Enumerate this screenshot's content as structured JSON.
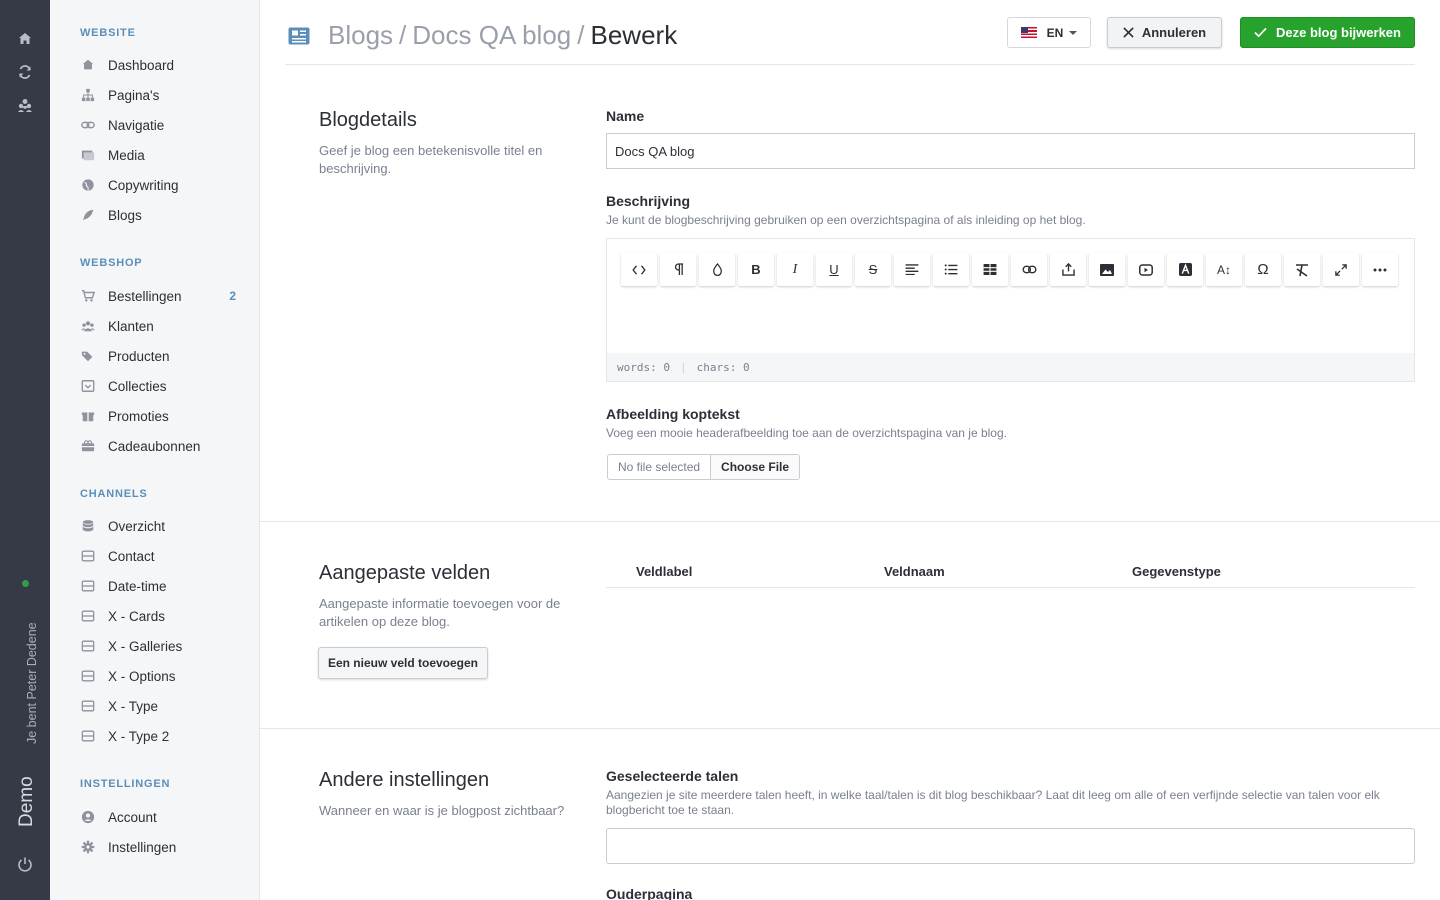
{
  "rail": {
    "user_text": "Je bent Peter Dedene",
    "site_name": "Demo",
    "icons": [
      "home-icon",
      "refresh-icon",
      "users-icon",
      "power-icon"
    ]
  },
  "sidebar": {
    "sections": [
      {
        "title": "WEBSITE",
        "items": [
          {
            "label": "Dashboard",
            "icon": "home-icon"
          },
          {
            "label": "Pagina's",
            "icon": "sitemap-icon"
          },
          {
            "label": "Navigatie",
            "icon": "link-icon"
          },
          {
            "label": "Media",
            "icon": "images-icon"
          },
          {
            "label": "Copywriting",
            "icon": "globe-icon"
          },
          {
            "label": "Blogs",
            "icon": "feather-icon"
          }
        ]
      },
      {
        "title": "WEBSHOP",
        "items": [
          {
            "label": "Bestellingen",
            "icon": "cart-icon",
            "badge": "2"
          },
          {
            "label": "Klanten",
            "icon": "users-icon"
          },
          {
            "label": "Producten",
            "icon": "tags-icon"
          },
          {
            "label": "Collecties",
            "icon": "collection-icon"
          },
          {
            "label": "Promoties",
            "icon": "gift-icon"
          },
          {
            "label": "Cadeaubonnen",
            "icon": "giftcard-icon"
          }
        ]
      },
      {
        "title": "CHANNELS",
        "items": [
          {
            "label": "Overzicht",
            "icon": "database-icon"
          },
          {
            "label": "Contact",
            "icon": "box-icon"
          },
          {
            "label": "Date-time",
            "icon": "box-icon"
          },
          {
            "label": "X - Cards",
            "icon": "box-icon"
          },
          {
            "label": "X - Galleries",
            "icon": "box-icon"
          },
          {
            "label": "X - Options",
            "icon": "box-icon"
          },
          {
            "label": "X - Type",
            "icon": "box-icon"
          },
          {
            "label": "X - Type 2",
            "icon": "box-icon"
          }
        ]
      },
      {
        "title": "INSTELLINGEN",
        "items": [
          {
            "label": "Account",
            "icon": "user-circle-icon"
          },
          {
            "label": "Instellingen",
            "icon": "gear-icon"
          }
        ]
      }
    ]
  },
  "header": {
    "crumb1": "Blogs",
    "crumb2": "Docs QA blog",
    "crumb3": "Bewerk",
    "sep": "/",
    "lang": "EN",
    "cancel": "Annuleren",
    "save": "Deze blog bijwerken"
  },
  "details": {
    "title": "Blogdetails",
    "desc": "Geef je blog een betekenisvolle titel en beschrijving.",
    "name_label": "Name",
    "name_value": "Docs QA blog",
    "desc_label": "Beschrijving",
    "desc_help": "Je kunt de blogbeschrijving gebruiken op een overzichtspagina of als inleiding op het blog.",
    "words": "words: 0",
    "chars": "chars: 0",
    "image_label": "Afbeelding koptekst",
    "image_help": "Voeg een mooie headerafbeelding toe aan de overzichtspagina van je blog.",
    "no_file": "No file selected",
    "choose_file": "Choose File"
  },
  "custom": {
    "title": "Aangepaste velden",
    "desc": "Aangepaste informatie toevoegen voor de artikelen op deze blog.",
    "col1": "Veldlabel",
    "col2": "Veldnaam",
    "col3": "Gegevenstype",
    "add": "Een nieuw veld toevoegen"
  },
  "other": {
    "title": "Andere instellingen",
    "desc": "Wanneer en waar is je blogpost zichtbaar?",
    "lang_label": "Geselecteerde talen",
    "lang_help": "Aangezien je site meerdere talen heeft, in welke taal/talen is dit blog beschikbaar? Laat dit leeg om alle of een verfijnde selectie van talen voor elk blogbericht toe te staan.",
    "parent_label": "Ouderpagina"
  },
  "colors": {
    "primary": "#27a32d",
    "accent": "#5b8fb9",
    "rail": "#353a46"
  }
}
